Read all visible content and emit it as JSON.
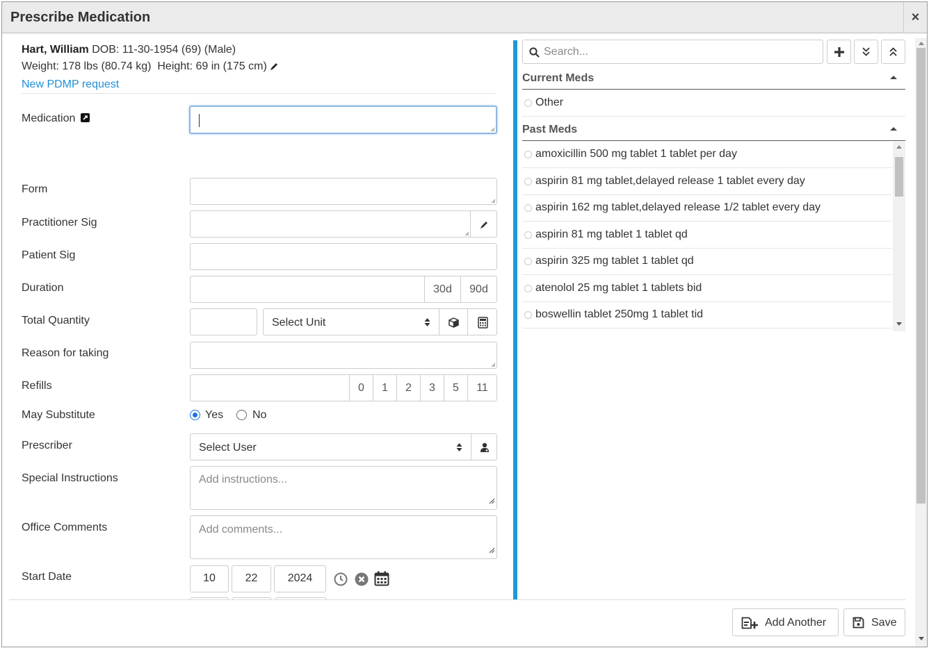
{
  "title": "Prescribe Medication",
  "close_label": "×",
  "patient": {
    "name": "Hart, William",
    "dob_line": "DOB: 11-30-1954 (69) (Male)",
    "vitals": "Weight: 178 lbs (80.74 kg)  Height: 69 in (175 cm)",
    "pdmp_link": "New PDMP request"
  },
  "form": {
    "medication": "Medication",
    "form": "Form",
    "practitioner_sig": "Practitioner Sig",
    "patient_sig": "Patient Sig",
    "duration": "Duration",
    "duration_30": "30d",
    "duration_90": "90d",
    "total_quantity": "Total Quantity",
    "select_unit": "Select Unit",
    "reason": "Reason for taking",
    "refills": "Refills",
    "refill_options": [
      "0",
      "1",
      "2",
      "3",
      "5",
      "11"
    ],
    "may_substitute": "May Substitute",
    "yes": "Yes",
    "no": "No",
    "prescriber": "Prescriber",
    "select_user": "Select User",
    "special_instructions": "Special Instructions",
    "instructions_placeholder": "Add instructions...",
    "office_comments": "Office Comments",
    "comments_placeholder": "Add comments...",
    "start_date": "Start Date",
    "start_month": "10",
    "start_day": "22",
    "start_year": "2024"
  },
  "meds_panel": {
    "search_placeholder": "Search...",
    "current_title": "Current Meds",
    "current_items": [
      "Other"
    ],
    "past_title": "Past Meds",
    "past_items": [
      "amoxicillin 500 mg tablet 1 tablet per day",
      "aspirin 81 mg tablet,delayed release 1 tablet every day",
      "aspirin 162 mg tablet,delayed release 1/2 tablet every day",
      "aspirin 81 mg tablet 1 tablet qd",
      "aspirin 325 mg tablet 1 tablet qd",
      "atenolol 25 mg tablet 1 tablets bid",
      "boswellin tablet 250mg 1 tablet tid"
    ]
  },
  "footer": {
    "add_another": "Add Another",
    "save": "Save"
  },
  "colors": {
    "accent": "#1c9ad6",
    "link": "#1f8fd6",
    "radio": "#1a73e8"
  }
}
